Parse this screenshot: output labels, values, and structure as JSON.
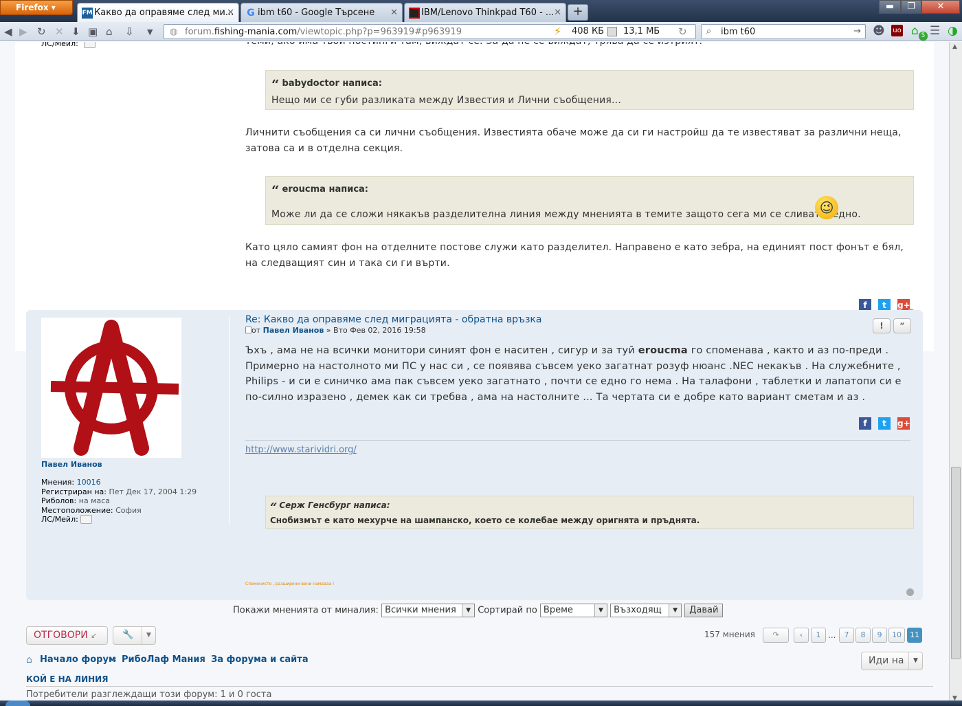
{
  "browser": {
    "menu_label": "Firefox",
    "tabs": [
      {
        "title": "Какво да оправяме след ми...",
        "favicon": "FM"
      },
      {
        "title": "ibm t60 - Google Търсене",
        "favicon": "G"
      },
      {
        "title": "IBM/Lenovo Thinkpad T60 - ...",
        "favicon": ""
      }
    ],
    "url_domain_prefix": "forum.",
    "url_domain": "fishing-mania.com",
    "url_path": "/viewtopic.php?p=963919#p963919",
    "stat_download": "408 КБ",
    "stat_memory": "13,1 МБ",
    "search_query": "ibm t60",
    "addon_badge": "5"
  },
  "post1": {
    "cut_top_text": "теми, ако има твои постинги там, виждат се. За да не се виждат, трява да се изтрият.",
    "cut_profile_label": "ЛС/Мейл:",
    "quote1_author": "babydoctor написа:",
    "quote1_text": "Нещо ми се губи разликата между Известия и Лични съобщения...",
    "para1": "Личнити съобщения са си лични съобщения. Известията обаче може да си ги настройш да те известяват за различни неща, затова са и в отделна секция.",
    "quote2_author": "eroucma написа:",
    "quote2_text": "Може ли да се сложи някакъв разделителна линия между мненията в темите защото сега ми се сливат в едно.",
    "para2": "Като цяло самият фон на отделните постове служи като разделител. Направено е като зебра, на единият пост фонът е бял, на следващият син и така си ги върти."
  },
  "post2": {
    "title": "Re: Какво да оправяме след миграцията - обратна връзка",
    "meta_from": "от",
    "author": "Павел Иванов",
    "date": "» Вто Фев 02, 2016 19:58",
    "body_a": "Ъхъ , ама не на всички монитори синият фон е наситен , сигур и за туй ",
    "body_bold": "eroucma",
    "body_b": " го споменава , както и аз по-преди . Примерно на настолното ми ПС у нас си , се появява съвсем уеко загатнат розуф нюанс .NEC некакъв . На служебните , Philips - и си е синичко ама пак съвсем уеко загатнато , почти се едно го нема . На талафони , таблетки и лапатопи си е по-силно изразено , демек как си требва , ама на настолните ... Та чертата си е добре като вариант сметам и аз .",
    "sig_link": "http://www.starividri.org/",
    "sig_quote_author": "Серж Генсбург написа:",
    "sig_quote_text": "Снобизмът е като мехурче на шампанско, което се колебае между оригнята и пръднята.",
    "sig_tiny": "Споменисте , разширени вени намаааа !",
    "profile": {
      "name": "Павел Иванов",
      "rows": [
        {
          "label": "Мнения:",
          "value": "10016"
        },
        {
          "label": "Регистриран на:",
          "value": "Пет Дек 17, 2004 1:29"
        },
        {
          "label": "Риболов:",
          "value": "на маса"
        },
        {
          "label": "Местоположение:",
          "value": "София"
        },
        {
          "label": "ЛС/Мейл:",
          "value": ""
        }
      ]
    }
  },
  "sortbar": {
    "show_label": "Покажи мненията от миналия:",
    "show_value": "Всички мнения",
    "sort_label": "Сортирай по",
    "sort_value": "Време",
    "dir_value": "Възходящ",
    "go_label": "Давай"
  },
  "actions": {
    "reply_label": "ОТГОВОРИ",
    "posts_count": "157 мнения",
    "pages": [
      "1",
      "...",
      "7",
      "8",
      "9",
      "10",
      "11"
    ],
    "current_page": "11"
  },
  "breadcrumb": {
    "home": "Начало форум",
    "sep": "‹",
    "cat": "РибоЛаф Мания",
    "forum": "За форума и сайта",
    "jump_label": "Иди на"
  },
  "online": {
    "heading": "КОЙ Е НА ЛИНИЯ",
    "text": "Потребители разглеждащи този форум: 1 и 0 госта"
  },
  "colors": {
    "link": "#105289",
    "reply": "#bc2a4d",
    "quote_bg": "#ebeadd",
    "post_alt_bg": "#e6edf5",
    "avatar_red": "#b01016"
  }
}
